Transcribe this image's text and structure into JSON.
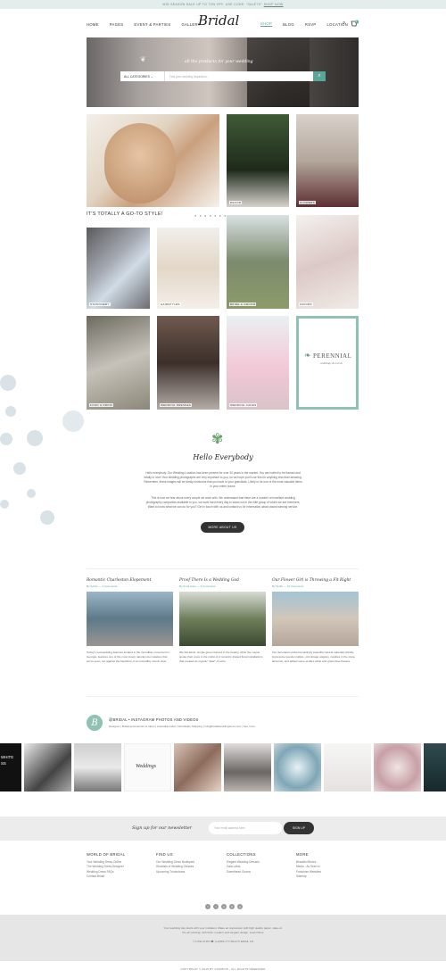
{
  "topbar": {
    "text": "MID SEASON SALE UP TO 70% OFF. USE CODE: \"SALE70\"",
    "link": "SHOP NOW"
  },
  "nav": {
    "left": [
      "HOME",
      "PAGES",
      "EVENT & PARTIES",
      "GALLERY"
    ],
    "right": [
      "SHOP",
      "BLOG",
      "RSVP",
      "LOCATION"
    ],
    "logo": "Bridal",
    "cart_count": "0"
  },
  "hero": {
    "tagline": "all the products for your wedding",
    "category": "ALL CATEGORIES",
    "search_placeholder": "Find your wedding inspiration..."
  },
  "feature_text": "IT'S TOTALLY A GO-TO STYLE!",
  "categories": {
    "decor": "DECOR",
    "flowers": "FLOWERS",
    "stationery": "STATIONERY",
    "hairstyles": "HAIRSTYLES",
    "bride_groom": "BRIDE & GROOM",
    "favors": "FAVORS",
    "food_drink": "FOOD & DRINK",
    "wedding_dresses": "WEDDING DRESSES",
    "wedding_cakes": "WEDDING CAKES",
    "perennial_title": "PERENNIAL",
    "perennial_sub": "weddings & events"
  },
  "hello": {
    "title": "Hello Everybody",
    "p1": "Hello everybody. Our Wedding Location has been present for over 20 years in the market. You are invited to be framed and totally in love! Your wedding photographs are very important to you, so we hope you'll use this for anything less than amazing. Remember, these images will be family heirlooms that you have to your grandkids. Likely to be one of the most valuable items in your entire house.",
    "p2": "This is how we fear about every couple we work with. We understand that there are a number of excellent wedding photography companies available to you, we work hard every day to stand out in the elite group of which we are members. Want to know what we can do for you? Get in touch with us and contact us for information about award winning service.",
    "button": "MORE ABOUT US"
  },
  "posts": [
    {
      "title": "Romantic Charleston Elopement",
      "meta": "By Admin  —  2 Comments",
      "excerpt": "Today's real-wedding features located in the incredible movement in Georgia, features one of the most lovely natural color palettes that we've seen, set against the backdrop of an incredibly scenic view."
    },
    {
      "title": "Proof There Is a Wedding God",
      "meta": "By Anna Anne  —  3 Comments",
      "excerpt": "We will admit, simple green framed in the beauty, while the couple spoke their vows in the midst of 2 romantic draped floral installations that created an organic \"altar\" of sorts."
    },
    {
      "title": "Our Flower Girl is Throwing a Fit Right",
      "meta": "By Smith  —  10 Comments",
      "excerpt": "Our decorators picked amazingly beautiful natural materials (kindly, impressive wooden tables, old vintage wagons, candles in the stone lanterns), and added some textiles while and grass-blue flowers."
    }
  ],
  "instagram": {
    "logo_letter": "B",
    "name": "@BRIDAL • INSTAGRAM PHOTOS AND VIDEOS",
    "bio": "Designer  |  Bridal accessories & robes  |  Australian label  |  Worldwide Shipping  |  info@bridalweddingstore.com  |  See more",
    "tiles": [
      "WHITE\nSS",
      "",
      "",
      "Weddings",
      "",
      "",
      "",
      "",
      "",
      ""
    ]
  },
  "newsletter": {
    "title": "Sign up for our newsletter",
    "placeholder": "Your email address here",
    "button": "SIGN UP"
  },
  "footer": [
    {
      "head": "WORLD OF BRIDAL",
      "items": [
        "Your Wedding Dress Online",
        "The Wedding Dress Designer",
        "Wedding Dress FAQs",
        "Contact Bridal"
      ]
    },
    {
      "head": "FIND US",
      "items": [
        "Our Wedding Dress Boutiques",
        "Stockists of Wedding Dresses",
        "Upcoming Trunkshows"
      ]
    },
    {
      "head": "COLLECTIONS",
      "items": [
        "Elegant Wedding Dresses",
        "Gala Labia",
        "Sweetheart Gowns"
      ]
    },
    {
      "head": "MORE",
      "items": [
        "Beautiful Brides",
        "Media - As Seen In",
        "Franchise Websites",
        "Sitemap"
      ]
    }
  ],
  "social": [
    "f",
    "t",
    "p",
    "in",
    "g"
  ],
  "bottom": {
    "line1": "Your wedding day starts with your invitation. Make an impression with high quality paper, state-of-",
    "line2": "the-art printing, with thick, modern and elegant design. Learn More",
    "contact": "☐ LIVE CHAT    ☎ (+1)564-777-5612    ✉ EMAIL US"
  },
  "copyright": "COPYRIGHT © 2016 BY COSMIOS - ALL RIGHTS RESERVED"
}
